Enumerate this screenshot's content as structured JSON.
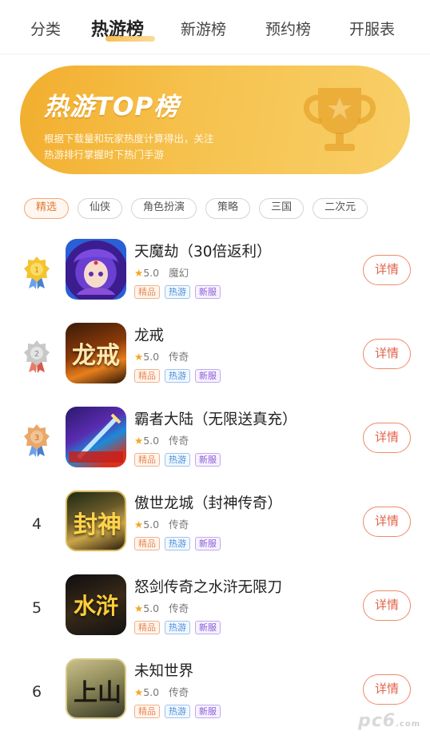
{
  "tabs": [
    {
      "label": "分类"
    },
    {
      "label": "热游榜"
    },
    {
      "label": "新游榜"
    },
    {
      "label": "预约榜"
    },
    {
      "label": "开服表"
    }
  ],
  "banner": {
    "title": "热游TOP榜",
    "desc_line1": "根据下载量和玩家热度计算得出，关注",
    "desc_line2": "热游排行掌握时下热门手游"
  },
  "chips": [
    {
      "label": "精选",
      "active": true
    },
    {
      "label": "仙侠"
    },
    {
      "label": "角色扮演"
    },
    {
      "label": "策略"
    },
    {
      "label": "三国"
    },
    {
      "label": "二次元"
    }
  ],
  "games": [
    {
      "rank": "1",
      "name": "天魔劫（30倍返利）",
      "rating": "5.0",
      "genre": "魔幻",
      "tags": [
        "精品",
        "热游",
        "新服"
      ],
      "detail": "详情",
      "medal": "gold"
    },
    {
      "rank": "2",
      "name": "龙戒",
      "rating": "5.0",
      "genre": "传奇",
      "tags": [
        "精品",
        "热游",
        "新服"
      ],
      "detail": "详情",
      "medal": "silver",
      "icon_text": "龙戒"
    },
    {
      "rank": "3",
      "name": "霸者大陆（无限送真充）",
      "rating": "5.0",
      "genre": "传奇",
      "tags": [
        "精品",
        "热游",
        "新服"
      ],
      "detail": "详情",
      "medal": "bronze"
    },
    {
      "rank": "4",
      "name": "傲世龙城（封神传奇）",
      "rating": "5.0",
      "genre": "传奇",
      "tags": [
        "精品",
        "热游",
        "新服"
      ],
      "detail": "详情",
      "icon_text": "封神"
    },
    {
      "rank": "5",
      "name": "怒剑传奇之水浒无限刀",
      "rating": "5.0",
      "genre": "传奇",
      "tags": [
        "精品",
        "热游",
        "新服"
      ],
      "detail": "详情",
      "icon_text": "水浒"
    },
    {
      "rank": "6",
      "name": "未知世界",
      "rating": "5.0",
      "genre": "传奇",
      "tags": [
        "精品",
        "热游",
        "新服"
      ],
      "detail": "详情",
      "icon_text": "上山"
    }
  ],
  "watermark": {
    "text": "pc6",
    "sub": ".com"
  },
  "colors": {
    "accent": "#f2ae2e",
    "detail_button": "#e2634a",
    "star": "#f5a623"
  }
}
